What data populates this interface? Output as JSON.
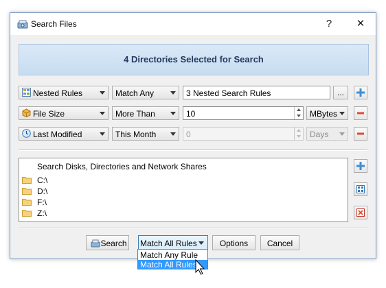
{
  "window": {
    "title": "Search Files",
    "help_label": "?",
    "close_label": "✕"
  },
  "banner": {
    "text": "4 Directories Selected for Search"
  },
  "rules": [
    {
      "type": "Nested Rules",
      "operator": "Match Any",
      "value": "3 Nested Search Rules",
      "browse_label": "...",
      "icon": "nested-rules-icon",
      "action": "add"
    },
    {
      "type": "File Size",
      "operator": "More Than",
      "value": "10",
      "unit": "MBytes",
      "icon": "file-size-icon",
      "action": "remove"
    },
    {
      "type": "Last Modified",
      "operator": "This Month",
      "value": "0",
      "unit": "Days",
      "icon": "clock-icon",
      "action": "remove",
      "disabled": true
    }
  ],
  "directories": {
    "header": "Search Disks, Directories and Network Shares",
    "items": [
      "C:\\",
      "D:\\",
      "F:\\",
      "Z:\\"
    ]
  },
  "buttons": {
    "search": "Search",
    "match": "Match All Rules",
    "options": "Options",
    "cancel": "Cancel"
  },
  "match_dropdown": {
    "options": [
      "Match Any Rule",
      "Match All Rules"
    ],
    "highlighted": "Match All Rules"
  },
  "colors": {
    "accent": "#3399ff",
    "banner_text": "#243a5e",
    "add_button": "#3f8fd6",
    "remove_button": "#e24a2c"
  }
}
